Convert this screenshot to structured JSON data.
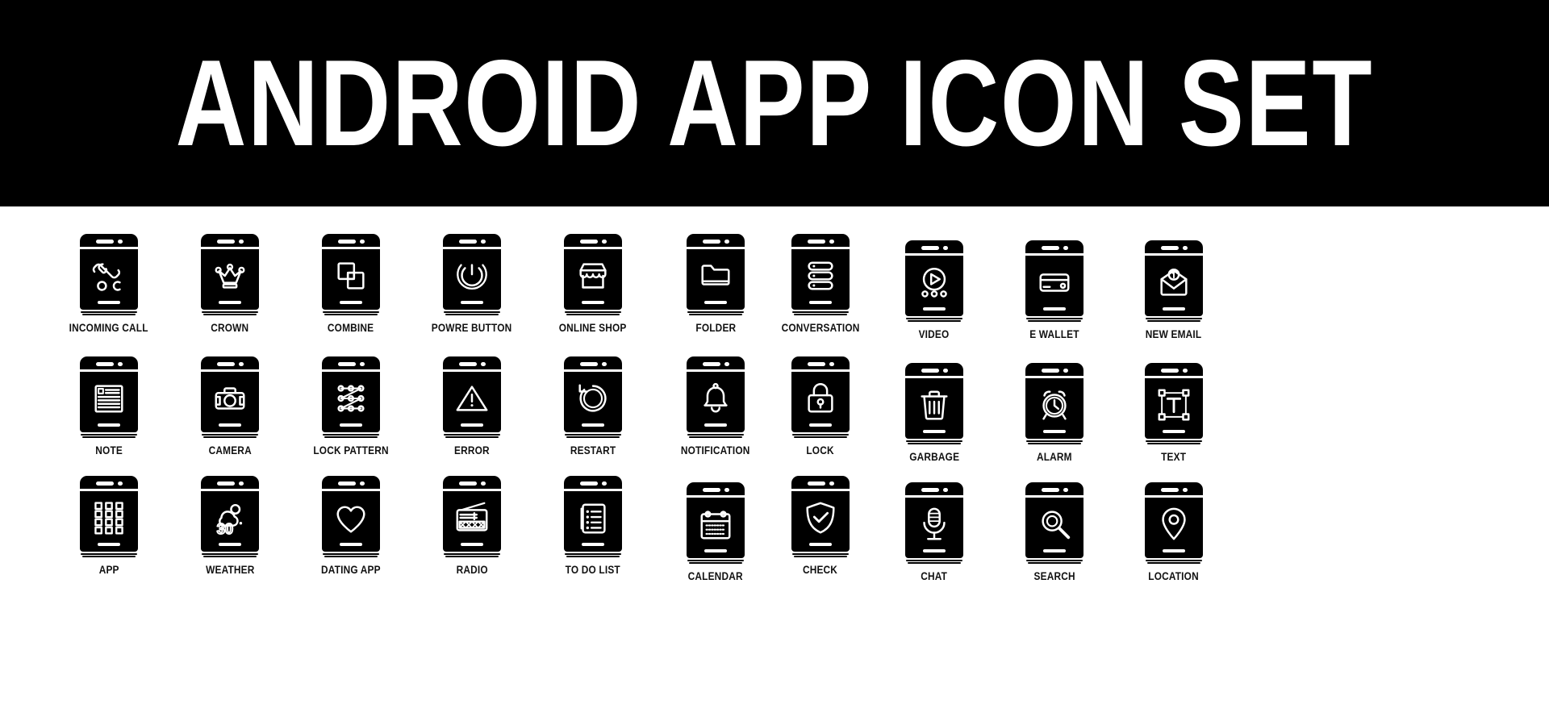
{
  "banner": {
    "title": "ANDROID APP ICON SET",
    "background_color": "#000000",
    "text_color": "#ffffff"
  },
  "theme": {
    "page_background": "#ffffff",
    "icon_fill": "#000000",
    "glyph_color": "#ffffff",
    "label_color": "#111111"
  },
  "grid": {
    "columns": 10,
    "rows": 3,
    "total_icons": 30
  },
  "icons": [
    {
      "label": "INCOMING CALL",
      "icon": "incoming-call-icon",
      "row": 1,
      "col": 1,
      "shift": false
    },
    {
      "label": "CROWN",
      "icon": "crown-icon",
      "row": 1,
      "col": 2,
      "shift": false
    },
    {
      "label": "COMBINE",
      "icon": "combine-icon",
      "row": 1,
      "col": 3,
      "shift": false
    },
    {
      "label": "POWRE BUTTON",
      "icon": "power-button-icon",
      "row": 1,
      "col": 4,
      "shift": false
    },
    {
      "label": "ONLINE SHOP",
      "icon": "online-shop-icon",
      "row": 1,
      "col": 5,
      "shift": false
    },
    {
      "label": "FOLDER",
      "icon": "folder-icon",
      "row": 1,
      "col": 6,
      "shift": false
    },
    {
      "label": "CONVERSATION",
      "icon": "conversation-icon",
      "row": 1,
      "col": 7,
      "shift": false
    },
    {
      "label": "VIDEO",
      "icon": "video-icon",
      "row": 1,
      "col": 8,
      "shift": true
    },
    {
      "label": "E WALLET",
      "icon": "e-wallet-icon",
      "row": 1,
      "col": 9,
      "shift": true
    },
    {
      "label": "NEW EMAIL",
      "icon": "new-email-icon",
      "row": 1,
      "col": 10,
      "shift": true
    },
    {
      "label": "NOTE",
      "icon": "note-icon",
      "row": 2,
      "col": 1,
      "shift": false
    },
    {
      "label": "CAMERA",
      "icon": "camera-icon",
      "row": 2,
      "col": 2,
      "shift": false
    },
    {
      "label": "LOCK PATTERN",
      "icon": "lock-pattern-icon",
      "row": 2,
      "col": 3,
      "shift": false
    },
    {
      "label": "ERROR",
      "icon": "error-icon",
      "row": 2,
      "col": 4,
      "shift": false
    },
    {
      "label": "RESTART",
      "icon": "restart-icon",
      "row": 2,
      "col": 5,
      "shift": false
    },
    {
      "label": "NOTIFICATION",
      "icon": "notification-icon",
      "row": 2,
      "col": 6,
      "shift": false
    },
    {
      "label": "LOCK",
      "icon": "lock-icon",
      "row": 2,
      "col": 7,
      "shift": false
    },
    {
      "label": "GARBAGE",
      "icon": "garbage-icon",
      "row": 2,
      "col": 8,
      "shift": true
    },
    {
      "label": "ALARM",
      "icon": "alarm-icon",
      "row": 2,
      "col": 9,
      "shift": true
    },
    {
      "label": "TEXT",
      "icon": "text-icon",
      "row": 2,
      "col": 10,
      "shift": true
    },
    {
      "label": "APP",
      "icon": "app-grid-icon",
      "row": 3,
      "col": 1,
      "shift": false
    },
    {
      "label": "WEATHER",
      "icon": "weather-icon",
      "row": 3,
      "col": 2,
      "shift": false
    },
    {
      "label": "DATING APP",
      "icon": "dating-app-icon",
      "row": 3,
      "col": 3,
      "shift": false
    },
    {
      "label": "RADIO",
      "icon": "radio-icon",
      "row": 3,
      "col": 4,
      "shift": false
    },
    {
      "label": "TO DO LIST",
      "icon": "to-do-list-icon",
      "row": 3,
      "col": 5,
      "shift": false
    },
    {
      "label": "CALENDAR",
      "icon": "calendar-icon",
      "row": 3,
      "col": 6,
      "shift": true
    },
    {
      "label": "CHECK",
      "icon": "check-icon",
      "row": 3,
      "col": 7,
      "shift": false
    },
    {
      "label": "CHAT",
      "icon": "chat-mic-icon",
      "row": 3,
      "col": 8,
      "shift": true
    },
    {
      "label": "SEARCH",
      "icon": "search-icon",
      "row": 3,
      "col": 9,
      "shift": true
    },
    {
      "label": "LOCATION",
      "icon": "location-icon",
      "row": 3,
      "col": 10,
      "shift": true
    }
  ],
  "weather": {
    "temperature": "30°"
  }
}
